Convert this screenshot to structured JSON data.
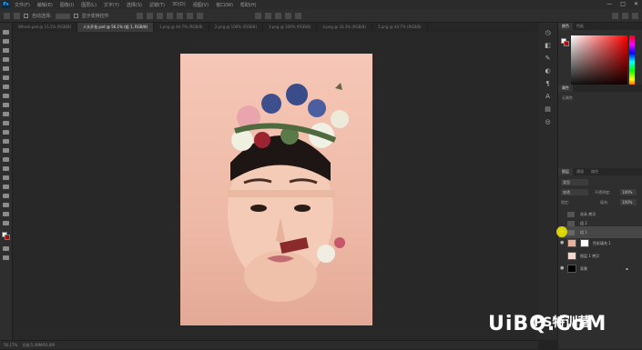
{
  "menubar": {
    "logo": "Ps",
    "menus": [
      "文件(F)",
      "编辑(E)",
      "图像(I)",
      "图层(L)",
      "文字(Y)",
      "选择(S)",
      "滤镜(T)",
      "3D(D)",
      "视图(V)",
      "窗口(W)",
      "帮助(H)"
    ],
    "window_controls": [
      "—",
      "□",
      "✕"
    ]
  },
  "optionsbar": {
    "auto_select_label": "自动选择:",
    "show_transform_label": "显示变换控件"
  },
  "tabs": [
    {
      "label": "Whosh.psd @ 15.1% (RGB/8)",
      "active": false
    },
    {
      "label": "人头开花.psd @ 56.1% (组 1, RGB/8)",
      "active": true
    },
    {
      "label": "1.png @ 44.7% (RGB/8)",
      "active": false
    },
    {
      "label": "2.png @ 100% (RGB/8)",
      "active": false
    },
    {
      "label": "3.png @ 100% (RGB/8)",
      "active": false
    },
    {
      "label": "4.png @ 33.3% (RGB/8)",
      "active": false
    },
    {
      "label": "5.png @ 44.7% (RGB/8)",
      "active": false
    }
  ],
  "statusbar": {
    "zoom": "56.17%",
    "doc_info": "文档:5.49M/93.6M"
  },
  "panels": {
    "color_tabs": [
      "颜色",
      "色板"
    ],
    "properties_tab": "属性",
    "properties_text": "无属性",
    "layers_tabs": [
      "图层",
      "通道",
      "路径"
    ],
    "kind_filter": "类型",
    "blend_mode": "穿透",
    "opacity_label": "不透明度:",
    "opacity_value": "100%",
    "lock_label": "锁定:",
    "fill_label": "填充:",
    "fill_value": "100%"
  },
  "layers": [
    {
      "name": "花朵 拷贝",
      "type": "group",
      "selected": false
    },
    {
      "name": "组 2",
      "type": "group",
      "selected": false
    },
    {
      "name": "组 1",
      "type": "group",
      "selected": true
    },
    {
      "name": "色彩填充 1",
      "type": "fill",
      "selected": false
    },
    {
      "name": "图层 1 拷贝",
      "type": "pixel",
      "selected": false
    },
    {
      "name": "背景",
      "type": "background",
      "selected": false
    }
  ],
  "watermark": {
    "logo": "UiBQ.CoM",
    "text": "PS特训营"
  }
}
